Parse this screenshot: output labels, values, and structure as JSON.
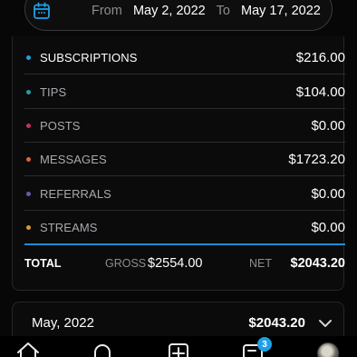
{
  "date_range": {
    "from_label": "From",
    "from_value": "May 2, 2022",
    "to_label": "To",
    "to_value": "May 17, 2022"
  },
  "earnings": {
    "rows": [
      {
        "label": "SUBSCRIPTIONS",
        "amount": "$216.00",
        "dot_color": "#1fa0e6",
        "label_color": "#ffffff"
      },
      {
        "label": "TIPS",
        "amount": "$104.00",
        "dot_color": "#2a9aa0",
        "label_color": "#a9a9ae"
      },
      {
        "label": "POSTS",
        "amount": "$0.00",
        "dot_color": "#c0306a",
        "label_color": "#a9a9ae"
      },
      {
        "label": "MESSAGES",
        "amount": "$1723.20",
        "dot_color": "#e0623a",
        "label_color": "#a9a9ae"
      },
      {
        "label": "REFERRALS",
        "amount": "$0.00",
        "dot_color": "#6a5aa8",
        "label_color": "#a9a9ae"
      },
      {
        "label": "STREAMS",
        "amount": "$0.00",
        "dot_color": "#d89a2a",
        "label_color": "#a9a9ae"
      }
    ],
    "total_label": "TOTAL",
    "gross_label": "GROSS",
    "gross_value": "$2554.00",
    "net_label": "NET",
    "net_value": "$2043.20",
    "accent_color": "#1f8fd0"
  },
  "month_summary": {
    "month": "May, 2022",
    "amount": "$2043.20",
    "chevron_icon": "chevron-down-icon"
  },
  "bottom_nav": {
    "items": [
      "home-icon",
      "notifications-icon",
      "add-post-icon",
      "messages-icon",
      "profile-avatar"
    ],
    "messages_badge": "3"
  }
}
